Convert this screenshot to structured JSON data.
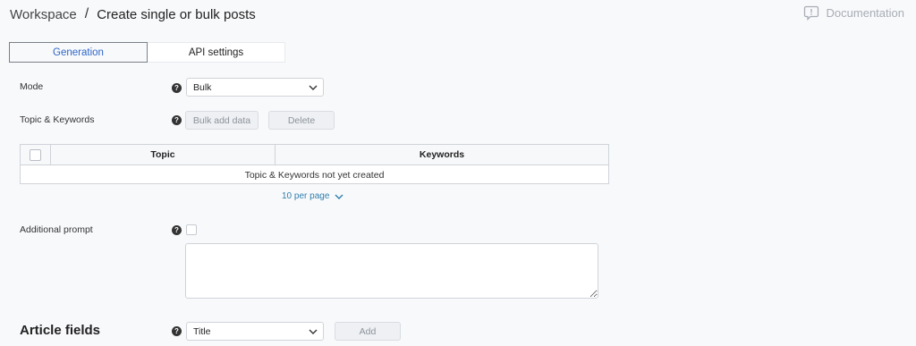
{
  "header": {
    "breadcrumb_root": "Workspace",
    "separator": "/",
    "page_title": "Create single or bulk posts",
    "docs_label": "Documentation"
  },
  "tabs": [
    {
      "label": "Generation",
      "active": true
    },
    {
      "label": "API settings",
      "active": false
    }
  ],
  "form": {
    "mode": {
      "label": "Mode",
      "value": "Bulk"
    },
    "topics": {
      "label": "Topic & Keywords",
      "bulk_add": "Bulk add data",
      "delete": "Delete"
    },
    "table": {
      "columns": [
        "Topic",
        "Keywords"
      ],
      "empty_text": "Topic & Keywords not yet created"
    },
    "pagination": {
      "per_page": "10 per page"
    },
    "additional_prompt": {
      "label": "Additional prompt",
      "value": ""
    },
    "article_fields": {
      "title": "Article fields",
      "select_value": "Title",
      "add": "Add"
    }
  },
  "colors": {
    "accent": "#2f66c7",
    "link": "#2f7fae",
    "background": "#f8f9fb"
  }
}
